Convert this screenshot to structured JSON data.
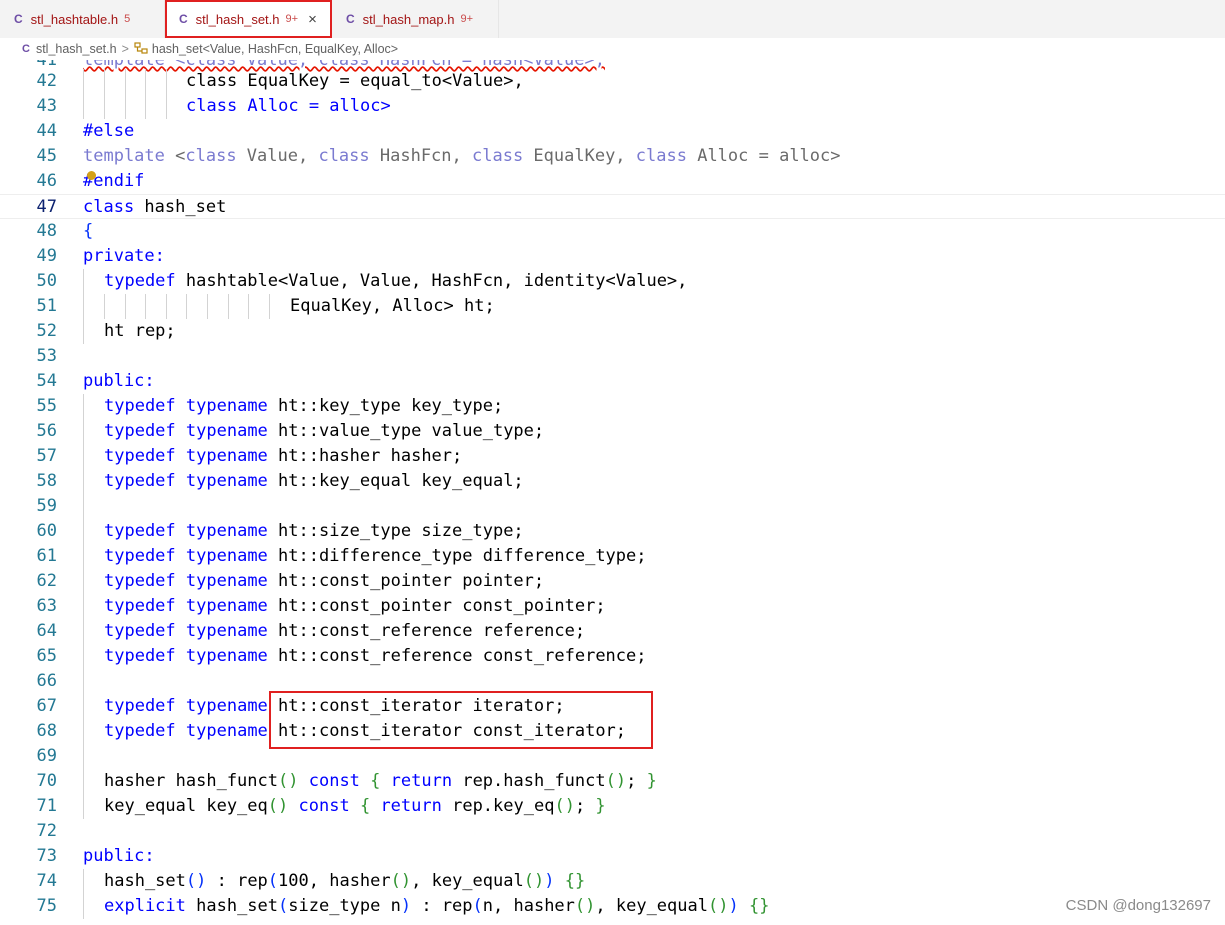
{
  "tabs": [
    {
      "lang": "C",
      "name": "stl_hashtable.h",
      "badge": "5"
    },
    {
      "lang": "C",
      "name": "stl_hash_set.h",
      "badge": "9+",
      "close": "×"
    },
    {
      "lang": "C",
      "name": "stl_hash_map.h",
      "badge": "9+"
    }
  ],
  "breadcrumb": {
    "lang": "C",
    "file": "stl_hash_set.h",
    "sep": ">",
    "symbol_icon": "symbol-class-icon",
    "symbol": "hash_set<Value, HashFcn, EqualKey, Alloc>"
  },
  "colors": {
    "keyword": "#0000ff",
    "line_number": "#237893",
    "highlight_box": "#e02020"
  },
  "code": {
    "l41": "template <class Value, class HashFcn = hash<Value>,",
    "n": [
      "41",
      "42",
      "43",
      "44",
      "45",
      "46",
      "47",
      "48",
      "49",
      "50",
      "51",
      "52",
      "53",
      "54",
      "55",
      "56",
      "57",
      "58",
      "59",
      "60",
      "61",
      "62",
      "63",
      "64",
      "65",
      "66",
      "67",
      "68",
      "69",
      "70",
      "71",
      "72",
      "73",
      "74",
      "75"
    ],
    "l42": "class EqualKey = equal_to<Value>,",
    "l43": "class Alloc = alloc>",
    "l44": "#else",
    "l45_a": "template",
    "l45_b": " <",
    "l45_c": "class",
    "l45_d": " Value, ",
    "l45_e": "class",
    "l45_f": " HashFcn, ",
    "l45_g": "class",
    "l45_h": " EqualKey, ",
    "l45_i": "class",
    "l45_j": " Alloc = alloc>",
    "l46": "#endif",
    "l47_a": "class",
    "l47_b": " hash_set",
    "l48": "{",
    "l49": "private:",
    "l50_a": "typedef",
    "l50_b": " hashtable<Value, Value, HashFcn, identity<Value>,",
    "l51": "EqualKey, Alloc> ht;",
    "l52": "ht rep;",
    "l54": "public:",
    "typedef": "typedef",
    "typename": "typename",
    "l55": " ht::key_type key_type;",
    "l56": " ht::value_type value_type;",
    "l57": " ht::hasher hasher;",
    "l58": " ht::key_equal key_equal;",
    "l60": " ht::size_type size_type;",
    "l61": " ht::difference_type difference_type;",
    "l62": " ht::const_pointer pointer;",
    "l63": " ht::const_pointer const_pointer;",
    "l64": " ht::const_reference reference;",
    "l65": " ht::const_reference const_reference;",
    "l67": " ht::const_iterator iterator;",
    "l68": " ht::const_iterator const_iterator;",
    "l70_a": "hasher hash_funct",
    "l70_b": "()",
    "l70_c": " ",
    "l70_d": "const",
    "l70_e": " ",
    "l70_f": "{",
    "l70_g": " ",
    "l70_h": "return",
    "l70_i": " rep.hash_funct",
    "l70_j": "()",
    "l70_k": "; ",
    "l70_l": "}",
    "l71_a": "key_equal key_eq",
    "l71_b": "()",
    "l71_c": " ",
    "l71_d": "const",
    "l71_e": " ",
    "l71_f": "{",
    "l71_g": " ",
    "l71_h": "return",
    "l71_i": " rep.key_eq",
    "l71_j": "()",
    "l71_k": "; ",
    "l71_l": "}",
    "l73": "public:",
    "l74_a": "hash_set",
    "l74_b": "()",
    "l74_c": " : rep",
    "l74_d": "(",
    "l74_e": "100, hasher",
    "l74_f": "()",
    "l74_g": ", key_equal",
    "l74_h": "()",
    "l74_i": ")",
    "l74_j": " ",
    "l74_k": "{}",
    "l75_a": "explicit",
    "l75_b": " hash_set",
    "l75_c": "(",
    "l75_d": "size_type n",
    "l75_e": ")",
    "l75_f": " : rep",
    "l75_g": "(",
    "l75_h": "n, hasher",
    "l75_i": "()",
    "l75_j": ", key_equal",
    "l75_k": "()",
    "l75_l": ")",
    "l75_m": " ",
    "l75_n": "{}"
  },
  "watermark": "CSDN @dong132697"
}
